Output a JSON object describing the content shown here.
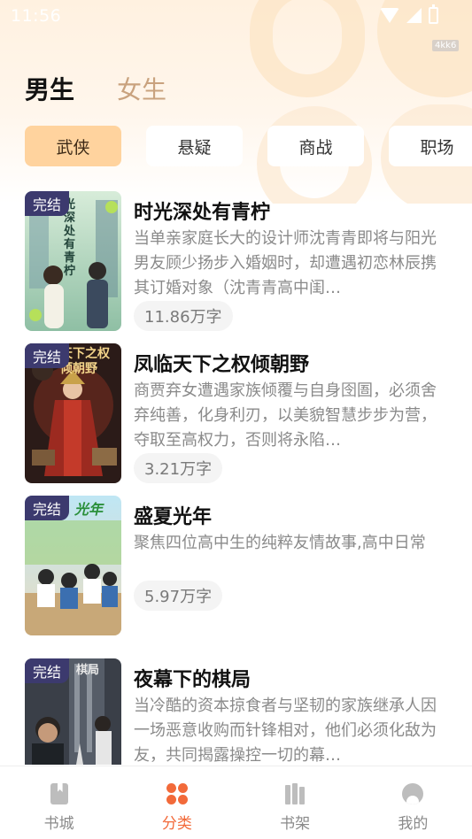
{
  "status_bar": {
    "time": "11:56",
    "watermark": "4kk6"
  },
  "gender_tabs": [
    {
      "label": "男生",
      "active": true
    },
    {
      "label": "女生",
      "active": false
    }
  ],
  "categories": [
    {
      "label": "武侠",
      "active": true
    },
    {
      "label": "悬疑",
      "active": false
    },
    {
      "label": "商战",
      "active": false
    },
    {
      "label": "职场",
      "active": false
    }
  ],
  "books": [
    {
      "badge": "完结",
      "cover_text": "光深处有青柠",
      "title": "时光深处有青柠",
      "desc": "当单亲家庭长大的设计师沈青青即将与阳光男友顾少扬步入婚姻时，却遭遇初恋林辰携其订婚对象（沈青青高中闺…",
      "words": "11.86万字"
    },
    {
      "badge": "完结",
      "cover_text": "天下之权倾朝野",
      "title": "凤临天下之权倾朝野",
      "desc": "商贾弃女遭遇家族倾覆与自身囹圄，必须舍弃纯善，化身利刃，以美貌智慧步步为营，夺取至高权力，否则将永陷…",
      "words": "3.21万字"
    },
    {
      "badge": "完结",
      "cover_text": "光年",
      "title": "盛夏光年",
      "desc": "聚焦四位高中生的纯粹友情故事,高中日常",
      "words": "5.97万字"
    },
    {
      "badge": "完结",
      "cover_text": "棋局",
      "title": "夜幕下的棋局",
      "desc": "当冷酷的资本掠食者与坚韧的家族继承人因一场恶意收购而针锋相对，他们必须化敌为友，共同揭露操控一切的幕…",
      "words": ""
    }
  ],
  "bottom_nav": [
    {
      "label": "书城",
      "icon": "bookstore-icon",
      "active": false
    },
    {
      "label": "分类",
      "icon": "category-icon",
      "active": true
    },
    {
      "label": "书架",
      "icon": "bookshelf-icon",
      "active": false
    },
    {
      "label": "我的",
      "icon": "profile-icon",
      "active": false
    }
  ],
  "colors": {
    "accent": "#f26a3a",
    "chip_active": "#ffd39e",
    "badge": "#3c3a6e"
  }
}
